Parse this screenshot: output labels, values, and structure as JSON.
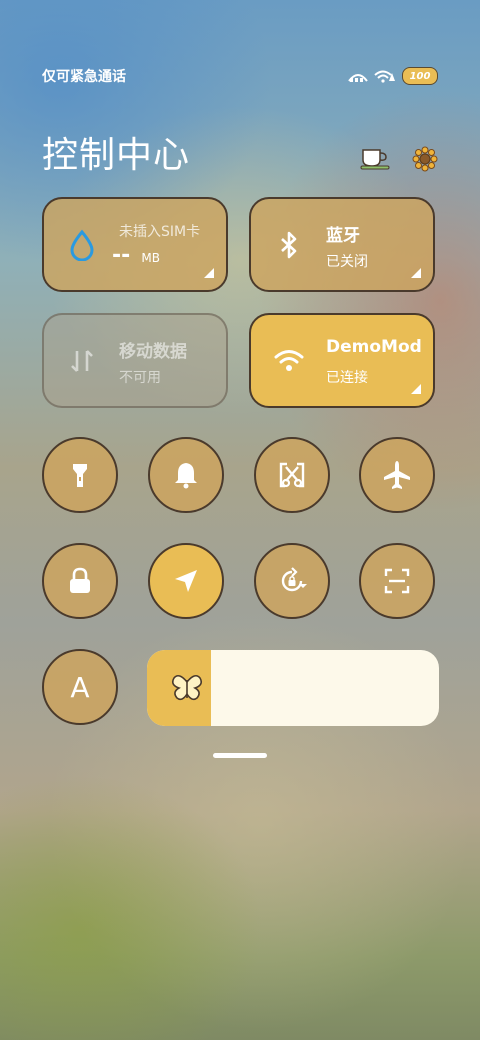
{
  "status_bar": {
    "carrier_text": "仅可紧急通话",
    "battery_text": "100",
    "icons": [
      "signal-icon",
      "wifi-icon",
      "battery-icon"
    ]
  },
  "header": {
    "title": "控制中心",
    "icons": [
      "tea-cup-icon",
      "sunflower-icon"
    ]
  },
  "tiles": {
    "data_usage": {
      "title": "未插入SIM卡",
      "value": "--",
      "unit": "MB",
      "icon": "water-drop-icon"
    },
    "bluetooth": {
      "title": "蓝牙",
      "status": "已关闭",
      "icon": "bluetooth-icon"
    },
    "mobile_data": {
      "title": "移动数据",
      "status": "不可用",
      "icon": "data-arrows-icon"
    },
    "wifi": {
      "title": "DemoMod",
      "status": "已连接",
      "icon": "wifi-icon"
    }
  },
  "toggles": [
    {
      "name": "flashlight",
      "icon": "flashlight-icon",
      "active": false
    },
    {
      "name": "sound",
      "icon": "bell-icon",
      "active": false
    },
    {
      "name": "screenshot",
      "icon": "scissors-icon",
      "active": false
    },
    {
      "name": "airplane",
      "icon": "airplane-icon",
      "active": false
    },
    {
      "name": "lock",
      "icon": "lock-icon",
      "active": false
    },
    {
      "name": "location",
      "icon": "location-arrow-icon",
      "active": true
    },
    {
      "name": "rotation-lock",
      "icon": "rotation-lock-icon",
      "active": false
    },
    {
      "name": "scanner",
      "icon": "scan-icon",
      "active": false
    }
  ],
  "font_toggle": {
    "label": "A"
  },
  "brightness": {
    "level": 0.22,
    "icon": "butterfly-icon"
  },
  "colors": {
    "accent": "#e9bd55",
    "tile": "#cda55f",
    "outline": "#4a3a2c",
    "slider_bg": "#fdf9ea"
  }
}
